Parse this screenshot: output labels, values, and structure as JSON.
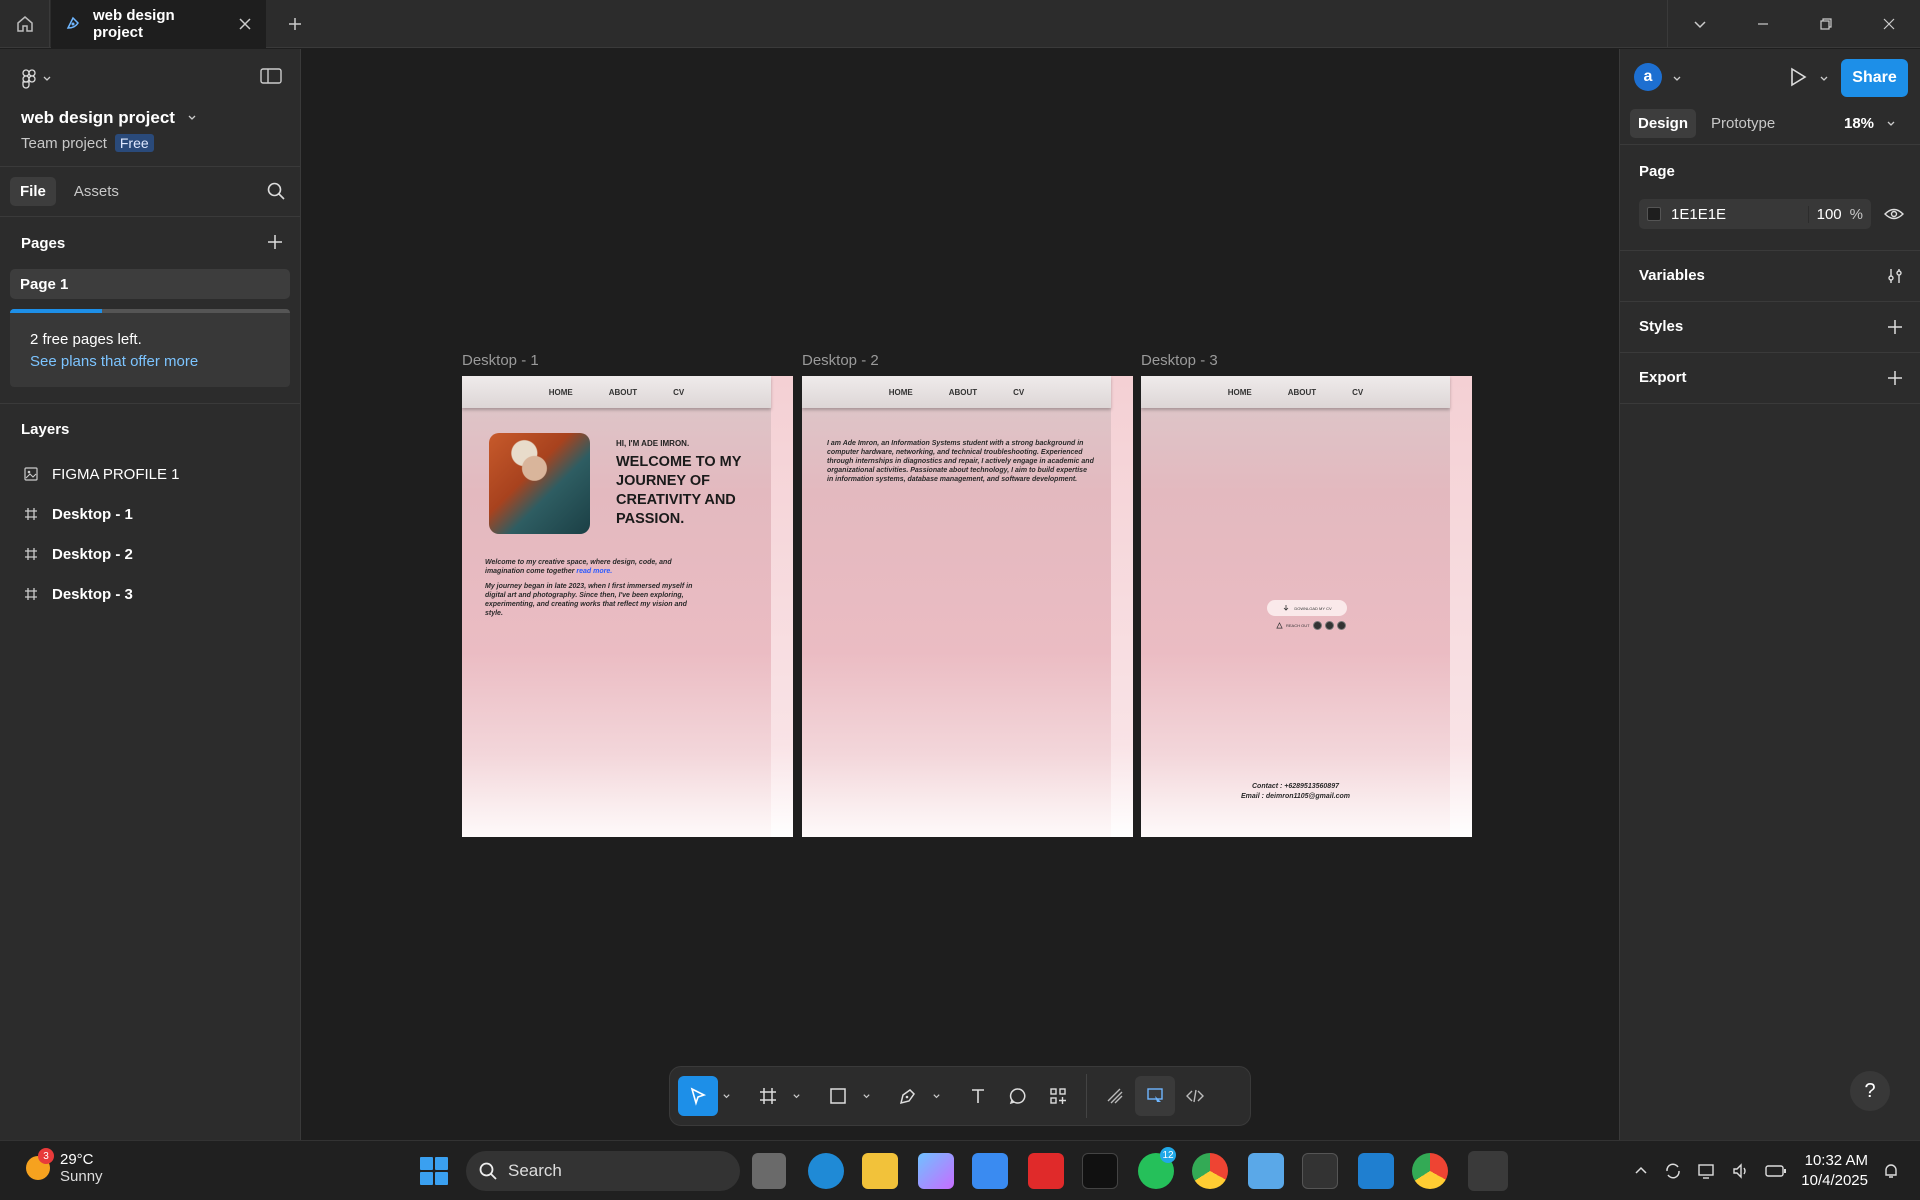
{
  "titlebar": {
    "tab_title": "web design project"
  },
  "left_panel": {
    "project_title": "web design project",
    "team": "Team project",
    "plan_badge": "Free",
    "tabs": [
      "File",
      "Assets"
    ],
    "pages_heading": "Pages",
    "pages": [
      "Page 1"
    ],
    "upsell": {
      "text": "2 free pages left.",
      "link": "See plans that offer more",
      "progress": 0.33
    },
    "layers_heading": "Layers",
    "layers": [
      {
        "name": "FIGMA PROFILE 1",
        "icon": "image-icon"
      },
      {
        "name": "Desktop - 1",
        "icon": "frame-icon"
      },
      {
        "name": "Desktop - 2",
        "icon": "frame-icon"
      },
      {
        "name": "Desktop - 3",
        "icon": "frame-icon"
      }
    ]
  },
  "canvas": {
    "frame_labels": [
      "Desktop - 1",
      "Desktop - 2",
      "Desktop - 3"
    ],
    "nav": [
      "HOME",
      "ABOUT",
      "CV"
    ],
    "frame1": {
      "hi": "HI, I'M ADE IMRON.",
      "welcome": "WELCOME TO MY JOURNEY OF CREATIVITY AND PASSION.",
      "p1": "Welcome to my creative space, where design, code, and imagination come together",
      "p1_link": "read more.",
      "p2": "My journey began in late 2023, when I first immersed myself in digital art and photography. Since then, I've been exploring, experimenting, and creating works that reflect my vision and style."
    },
    "frame2": {
      "text": "I am Ade Imron, an Information Systems student with a strong background in computer hardware, networking, and technical troubleshooting. Experienced through internships in diagnostics and repair, I actively engage in academic and organizational activities. Passionate about technology, I aim to build expertise in information systems, database management, and software development."
    },
    "frame3": {
      "pill": "DOWNLOAD MY CV",
      "reach": "REACH OUT",
      "contact": "Contact : +6289513560897",
      "email": "Email : deimron1105@gmail.com"
    }
  },
  "right_panel": {
    "avatar": "a",
    "share": "Share",
    "tabs": [
      "Design",
      "Prototype"
    ],
    "zoom": "18%",
    "page_heading": "Page",
    "bg_hex": "1E1E1E",
    "bg_opacity": "100",
    "bg_pct": "%",
    "variables": "Variables",
    "styles": "Styles",
    "export": "Export",
    "help": "?"
  },
  "taskbar": {
    "weather_badge": "3",
    "temp": "29°C",
    "condition": "Sunny",
    "search": "Search",
    "whatsapp_badge": "12",
    "time": "10:32 AM",
    "date": "10/4/2025"
  },
  "colors": {
    "accent": "#1d8fe8",
    "canvas": "#1e1e1e",
    "panel": "#2c2c2c"
  }
}
